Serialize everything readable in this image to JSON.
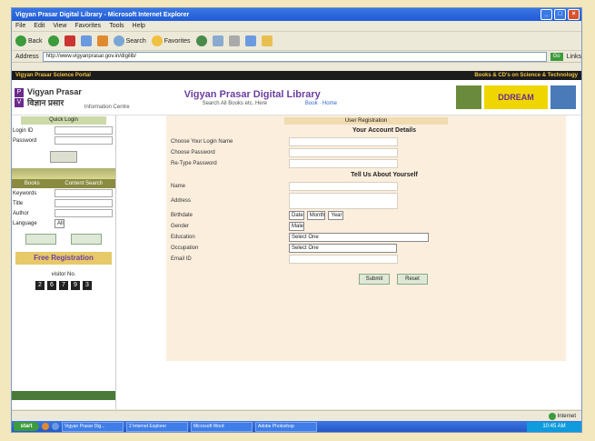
{
  "window": {
    "title": "Vigyan Prasar Digital Library - Microsoft Internet Explorer"
  },
  "menu": [
    "File",
    "Edit",
    "View",
    "Favorites",
    "Tools",
    "Help"
  ],
  "toolbar": {
    "back": "Back",
    "search": "Search",
    "favorites": "Favorites"
  },
  "address": {
    "label": "Address",
    "url": "http://www.vigyanprasar.gov.in/digilib/",
    "go": "Go",
    "links": "Links"
  },
  "site": {
    "name": "Vigyan Prasar Science Portal",
    "tagline": "Books & CD's on Science & Technology"
  },
  "header": {
    "logo_name": "Vigyan Prasar",
    "logo_hindi": "विज्ञान प्रसार",
    "logo_sub": "Information Centre",
    "title": "Vigyan Prasar Digital Library",
    "subtitle": "Search All Books etc. Here",
    "nav": "Book · Home",
    "banner": "DDREAM"
  },
  "sidebar": {
    "login_head": "Quick Login",
    "login_id": "Login ID",
    "password": "Password",
    "band_left": "Books",
    "band_right": "Content Search",
    "fields": [
      {
        "label": "Keywords"
      },
      {
        "label": "Title"
      },
      {
        "label": "Author"
      },
      {
        "label": "Language",
        "value": "All"
      }
    ],
    "free_reg": "Free Registration",
    "visitor_label": "visitor No.",
    "counter": [
      "2",
      "6",
      "7",
      "9",
      "3"
    ]
  },
  "form": {
    "section_title": "User Registration",
    "account_head": "Your Account Details",
    "login_name": "Choose Your Login Name",
    "choose_password": "Choose Password",
    "retype_password": "Re-Type Password",
    "about_head": "Tell Us About Yourself",
    "name": "Name",
    "address": "Address",
    "birthdate": "Birthdate",
    "birth_day": "Date",
    "birth_month": "Month",
    "birth_year": "Year",
    "gender": "Gender",
    "gender_value": "Male",
    "education": "Education",
    "education_value": "Select One",
    "occupation": "Occupation",
    "occupation_value": "Select One",
    "email": "Email ID",
    "submit": "Submit",
    "reset": "Reset"
  },
  "status": {
    "zone": "Internet"
  },
  "taskbar": {
    "start": "start",
    "tasks": [
      "Vigyan Prasar Dig...",
      "2 Internet Explorer",
      "Microsoft Word",
      "Adobe Photoshop"
    ],
    "clock": "10:45 AM"
  }
}
